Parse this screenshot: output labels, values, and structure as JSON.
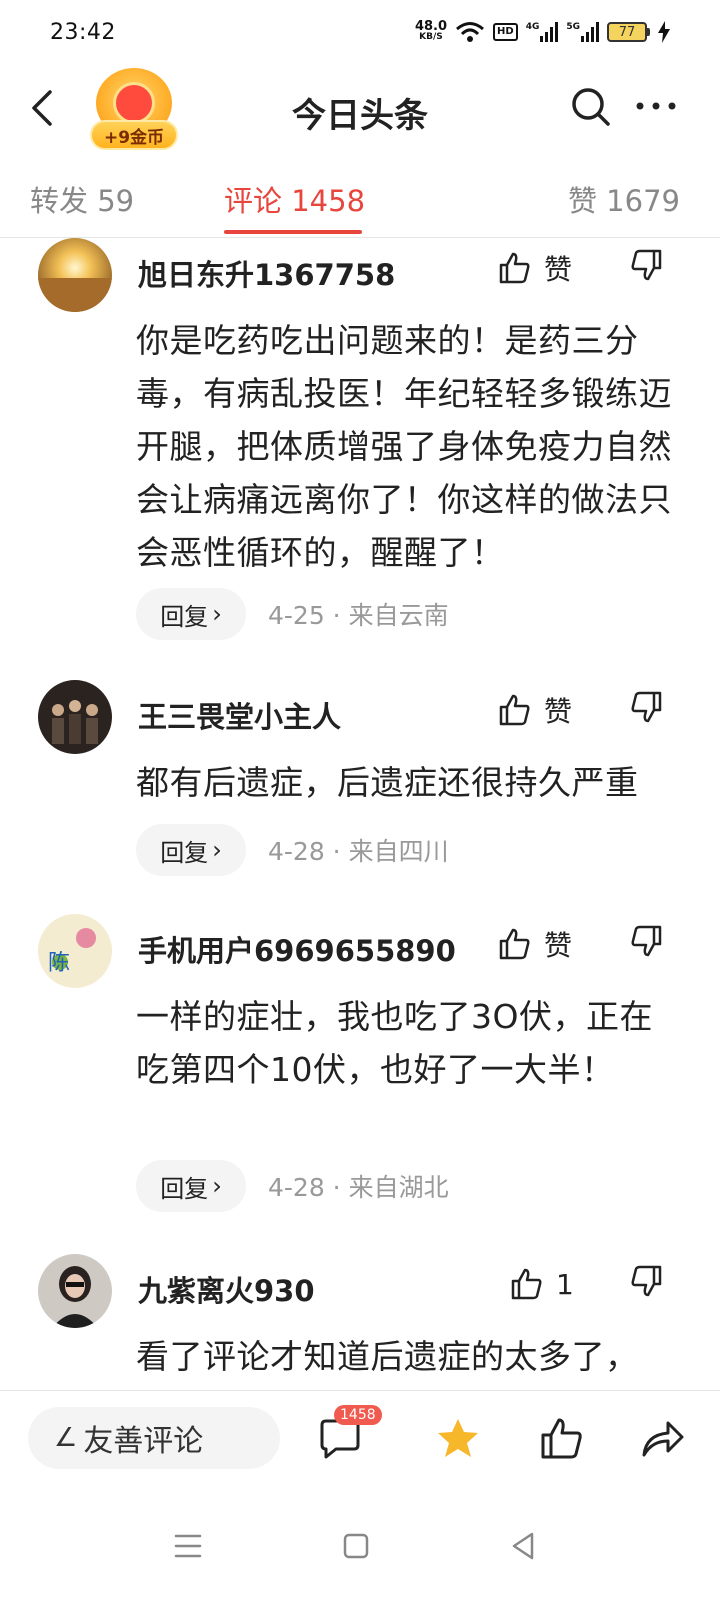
{
  "status_bar": {
    "time": "23:42",
    "speed_value": "48.0",
    "speed_unit": "KB/S",
    "hd_label": "HD",
    "net1_label": "4G",
    "net2_label": "5G",
    "battery": "77",
    "battery_color": "#f4d35e"
  },
  "header": {
    "title": "今日头条",
    "coin_badge_label": "+9金币",
    "icons": [
      "back-icon",
      "search-icon",
      "more-icon"
    ]
  },
  "tabs": {
    "forward": "转发 59",
    "comment": "评论 1458",
    "like": "赞 1679",
    "active_color": "#e8453c"
  },
  "comments": [
    {
      "user": "旭日东升1367758",
      "like_label": "赞",
      "text": "你是吃药吃出问题来的！是药三分毒，有病乱投医！年纪轻轻多锻练迈开腿，把体质增强了身体免疫力自然会让病痛远离你了！你这样的做法只会恶性循环的，醒醒了！",
      "reply_label": "回复",
      "meta": "4-25 · 来自云南"
    },
    {
      "user": "王三畏堂小主人",
      "like_label": "赞",
      "text": "都有后遗症，后遗症还很持久严重",
      "reply_label": "回复",
      "meta": "4-28 · 来自四川"
    },
    {
      "user": "手机用户6969655890",
      "like_label": "赞",
      "text": "一样的症壮，我也吃了3O伏，正在吃第四个10伏，也好了一大半！",
      "reply_label": "回复",
      "meta": "4-28 · 来自湖北"
    },
    {
      "user": "九紫离火930",
      "like_label": "1",
      "text": "看了评论才知道后遗症的太多了，",
      "reply_label": "",
      "meta": ""
    }
  ],
  "bottom_bar": {
    "input_placeholder": "友善评论",
    "comment_count_badge": "1458",
    "star_color": "#f7b72b"
  }
}
